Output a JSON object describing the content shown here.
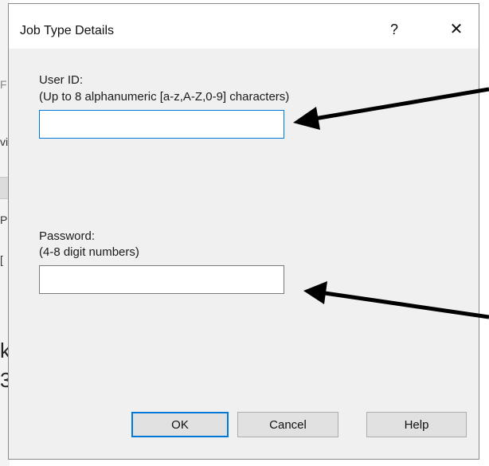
{
  "dialog": {
    "title": "Job Type Details",
    "help_glyph": "?",
    "close_glyph": "✕"
  },
  "user_id": {
    "label": "User ID:",
    "hint": "(Up to 8 alphanumeric [a-z,A-Z,0-9] characters)",
    "value": ""
  },
  "password": {
    "label": "Password:",
    "hint": "(4-8 digit numbers)",
    "value": ""
  },
  "buttons": {
    "ok": "OK",
    "cancel": "Cancel",
    "help": "Help"
  },
  "background_fragments": {
    "f1": "F",
    "f2": "vi",
    "f3": "P",
    "f4": "[",
    "f5": "k",
    "f6": "3"
  },
  "colors": {
    "focus_accent": "#0078d7",
    "annotation_arrow": "#000000"
  }
}
